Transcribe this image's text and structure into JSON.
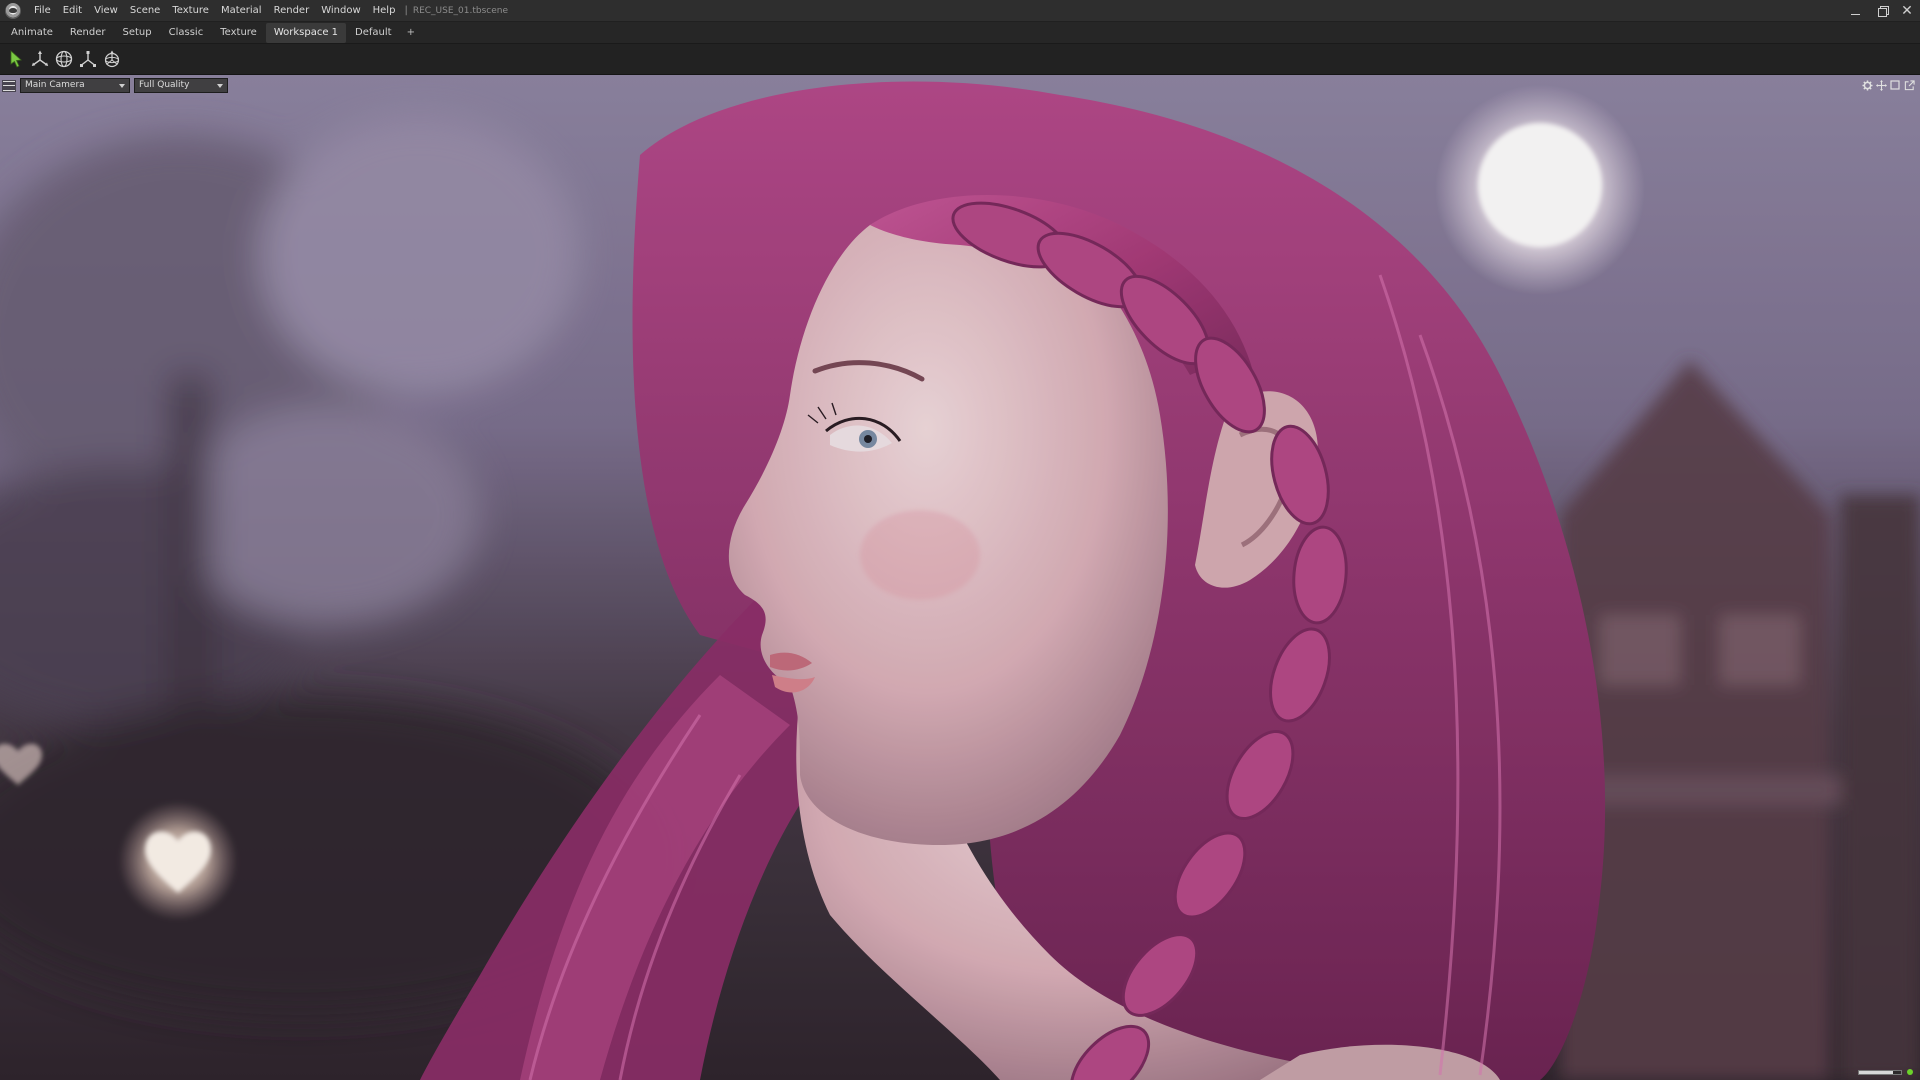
{
  "window": {
    "document_title": "REC_USE_01.tbscene",
    "separator": "|"
  },
  "menu": {
    "items": [
      "File",
      "Edit",
      "View",
      "Scene",
      "Texture",
      "Material",
      "Render",
      "Window",
      "Help"
    ]
  },
  "tabs": {
    "items": [
      "Animate",
      "Render",
      "Setup",
      "Classic",
      "Texture",
      "Workspace 1",
      "Default"
    ],
    "active": "Workspace 1",
    "add_label": "+"
  },
  "toolbar": {
    "tools": [
      "select-arrow-icon",
      "translate-gizmo-icon",
      "rotate-gizmo-icon",
      "scale-gizmo-icon",
      "transform-all-icon"
    ],
    "accent_color": "#7ac943"
  },
  "viewport": {
    "camera": "Main Camera",
    "quality": "Full Quality",
    "right_icons": [
      "settings-icon",
      "move-icon",
      "maximize-icon",
      "popout-icon"
    ],
    "render_progress": 0.8,
    "status_color": "#6bd32a"
  },
  "colors": {
    "hair": "#b0407e",
    "skin": "#e8c6c8",
    "background": "#5a5064"
  }
}
